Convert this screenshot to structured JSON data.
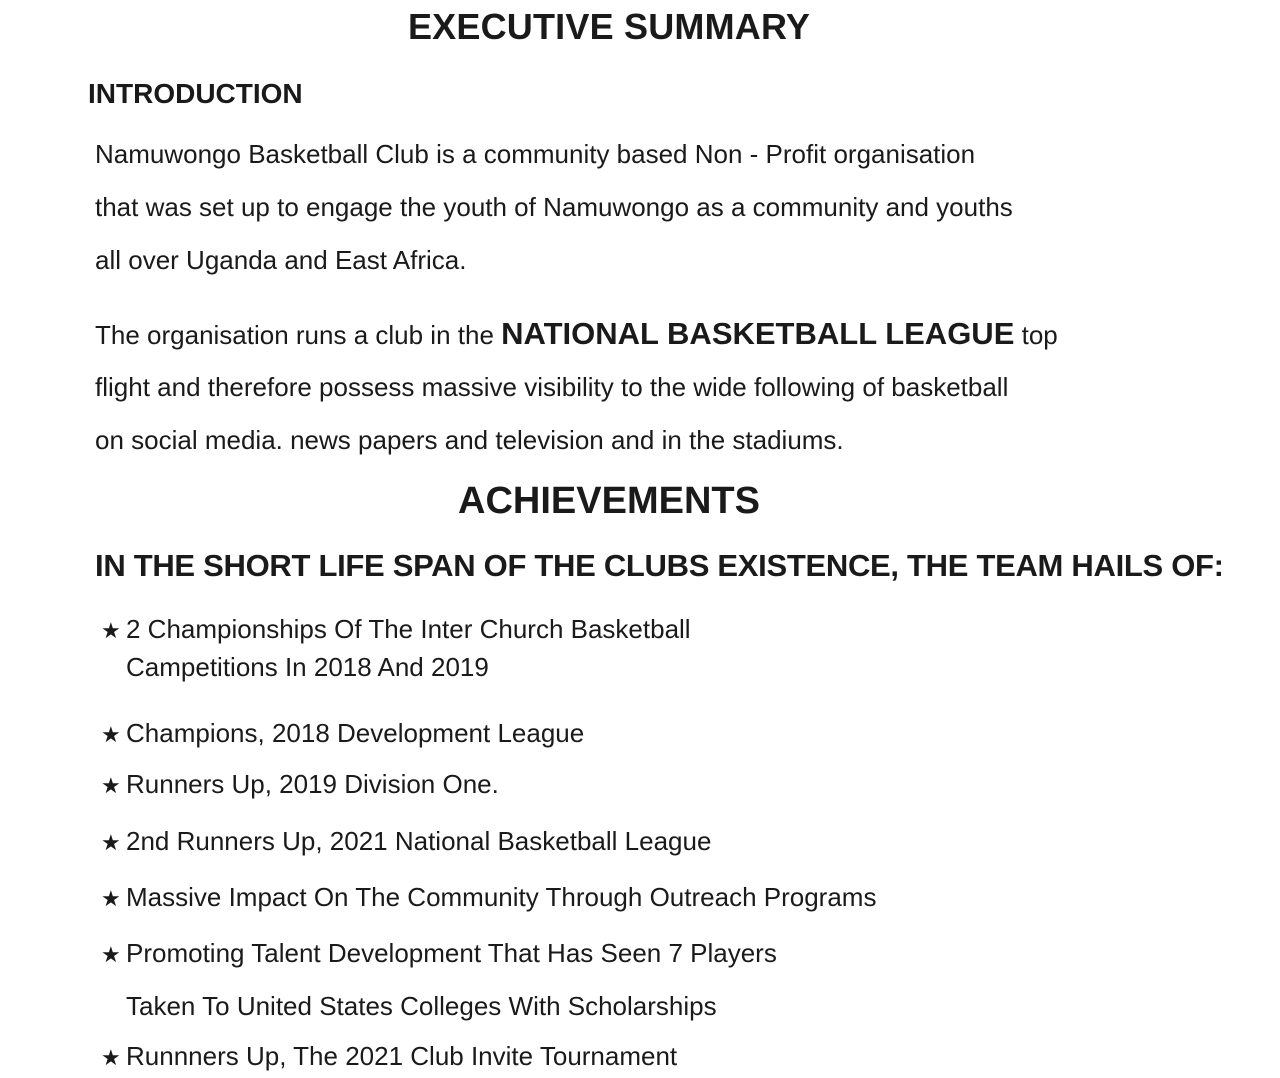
{
  "title": "EXECUTIVE SUMMARY",
  "introduction": {
    "heading": "INTRODUCTION",
    "paragraph1": [
      "Namuwongo Basketball Club is a community based Non - Profit organisation",
      "that was set up to engage the youth of Namuwongo as a community and youths",
      "all over Uganda and East Africa."
    ],
    "paragraph2": {
      "line1_before": "The organisation runs a club in the ",
      "line1_emphasis": "NATIONAL BASKETBALL LEAGUE",
      "line1_after": " top",
      "line2": "flight and therefore possess massive visibility to the wide following of basketball",
      "line3": "on social media. news papers and television and in the stadiums."
    }
  },
  "achievements": {
    "heading": "ACHIEVEMENTS",
    "subheading": "IN THE SHORT LIFE SPAN OF THE CLUBS EXISTENCE, THE TEAM HAILS OF:",
    "bullet_icon": "star-icon",
    "items": [
      {
        "line1": "2 Championships Of The Inter Church Basketball",
        "line2": "Campetitions In 2018 And 2019"
      },
      {
        "line1": "Champions, 2018 Development League"
      },
      {
        "line1": "Runners Up, 2019 Division One."
      },
      {
        "line1": "2nd Runners Up, 2021 National Basketball League"
      },
      {
        "line1": "Massive Impact On The Community Through Outreach Programs"
      },
      {
        "line1": "Promoting Talent Development That Has Seen 7 Players",
        "line2": "Taken To United States Colleges With Scholarships"
      },
      {
        "line1": "Runnners Up, The 2021 Club Invite Tournament"
      }
    ]
  }
}
